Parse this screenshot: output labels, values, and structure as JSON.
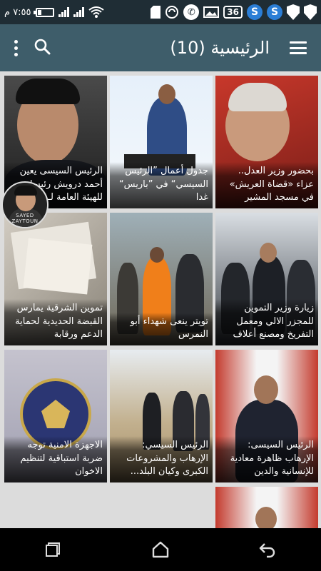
{
  "status_bar": {
    "time": "٧:٥٥ م",
    "badge_number": "36",
    "icons": [
      "battery-icon",
      "signal-icon",
      "signal-icon",
      "wifi-icon",
      "sim-icon",
      "sync-icon",
      "phone-icon",
      "image-icon",
      "s-icon",
      "s-icon",
      "shield-icon",
      "shield-icon"
    ]
  },
  "toolbar": {
    "title": "الرئيسية (10)",
    "menu_icon": "hamburger-icon",
    "search_icon": "search-icon",
    "more_icon": "more-vertical-icon"
  },
  "articles": [
    {
      "caption": "بحضور وزير العدل.. عزاء «قضاة العريش» في مسجد المشير",
      "colors": [
        "#c23a2a",
        "#7a2a24"
      ]
    },
    {
      "caption": "جدول أعمال ”الرئيس السيسي“ في ”باريس“ غدا",
      "colors": [
        "#cfe3f5",
        "#e8f1fa"
      ]
    },
    {
      "caption": "الرئيس السيسى يعين أحمد درويش رئيسا للهيئة العامة لـ...",
      "colors": [
        "#3a3a3a",
        "#1a1a1a"
      ]
    },
    {
      "caption": "زيارة وزير التموين للمجزر الالي ومعمل التفريخ ومصنع أعلاف",
      "colors": [
        "#5a5f66",
        "#2a2e33"
      ]
    },
    {
      "caption": "تويتر ينعى شهداء أبو النمرس",
      "colors": [
        "#8a8270",
        "#5a5448"
      ]
    },
    {
      "caption": "تموين الشرقية يمارس القبضة الحديدية لحماية الدعم ورقابة",
      "colors": [
        "#b9b2a6",
        "#8c867c"
      ]
    },
    {
      "caption": "الرئيس السيسى: الإرهاب ظاهرة معادية للإنسانية والدين",
      "colors": [
        "#c8473a",
        "#7d2a22"
      ]
    },
    {
      "caption": "الرئيس السيسي: الإرهاب والمشروعات الكبرى وكيان البلد...",
      "colors": [
        "#c9b89a",
        "#9a8a6e"
      ]
    },
    {
      "caption": "الاجهزة الامنية توجه ضربة استباقية لتنظيم الاخوان",
      "colors": [
        "#b7b6c8",
        "#2f3b7a"
      ]
    }
  ],
  "avatar": {
    "label": "SAYED ZAYTOUN"
  },
  "nav_bar": {
    "recents_icon": "recents-icon",
    "home_icon": "home-icon",
    "back_icon": "back-icon"
  },
  "colors": {
    "status_bar": "#1f2d35",
    "toolbar": "#3e5d6a",
    "background": "#dcdcdc"
  }
}
